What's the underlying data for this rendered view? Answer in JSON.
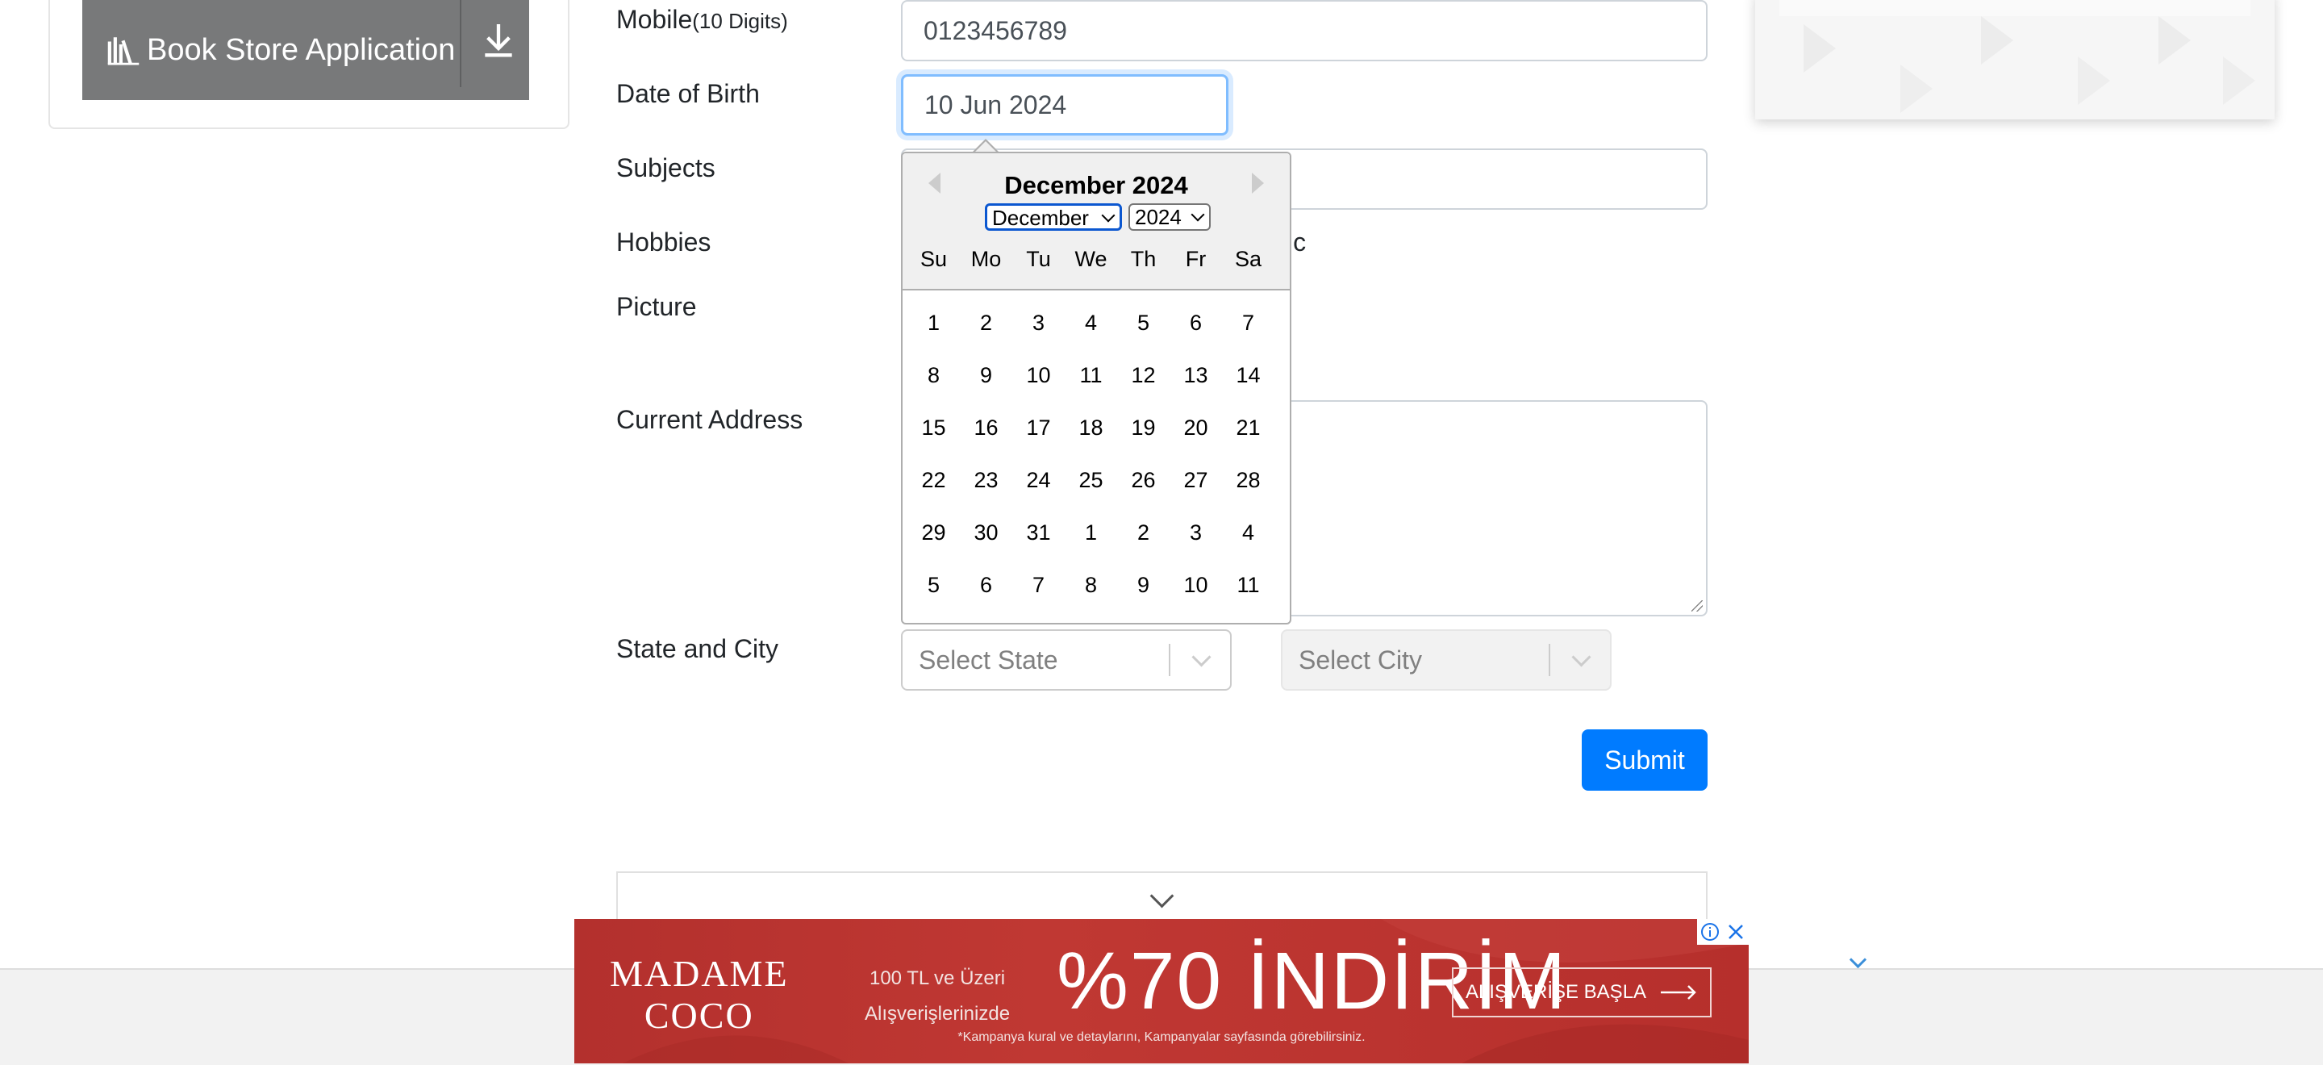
{
  "sidebar": {
    "book_store_label": "Book Store Application"
  },
  "form": {
    "mobile_label": "Mobile",
    "mobile_hint": "(10 Digits)",
    "mobile_value": "0123456789",
    "dob_label": "Date of Birth",
    "dob_value": "10 Jun 2024",
    "subjects_label": "Subjects",
    "hobbies_label": "Hobbies",
    "hobbies_partial_text": "ic",
    "picture_label": "Picture",
    "address_label": "Current Address",
    "state_city_label": "State and City",
    "state_placeholder": "Select State",
    "city_placeholder": "Select City",
    "submit_label": "Submit"
  },
  "datepicker": {
    "title": "December 2024",
    "month_select": "December",
    "year_select": "2024",
    "weekdays": [
      "Su",
      "Mo",
      "Tu",
      "We",
      "Th",
      "Fr",
      "Sa"
    ],
    "weeks": [
      [
        "1",
        "2",
        "3",
        "4",
        "5",
        "6",
        "7"
      ],
      [
        "8",
        "9",
        "10",
        "11",
        "12",
        "13",
        "14"
      ],
      [
        "15",
        "16",
        "17",
        "18",
        "19",
        "20",
        "21"
      ],
      [
        "22",
        "23",
        "24",
        "25",
        "26",
        "27",
        "28"
      ],
      [
        "29",
        "30",
        "31",
        "1",
        "2",
        "3",
        "4"
      ],
      [
        "5",
        "6",
        "7",
        "8",
        "9",
        "10",
        "11"
      ]
    ]
  },
  "banner_ad": {
    "brand_line1": "MADAME",
    "brand_line2": "COCO",
    "small_line1": "100 TL ve Üzeri",
    "small_line2": "Alışverişlerinizde",
    "headline": "%70 İNDİRİM",
    "cta": "ALIŞVERİŞE BAŞLA",
    "fine_print": "*Kampanya kural ve detaylarını, Kampanyalar sayfasında görebilirsiniz.",
    "info_icon": "info-icon",
    "close_icon": "close-icon"
  },
  "colors": {
    "primary": "#007bff",
    "sidebar_button": "#78797a",
    "banner_red": "#b3302d",
    "focus_ring": "#80bdff"
  }
}
